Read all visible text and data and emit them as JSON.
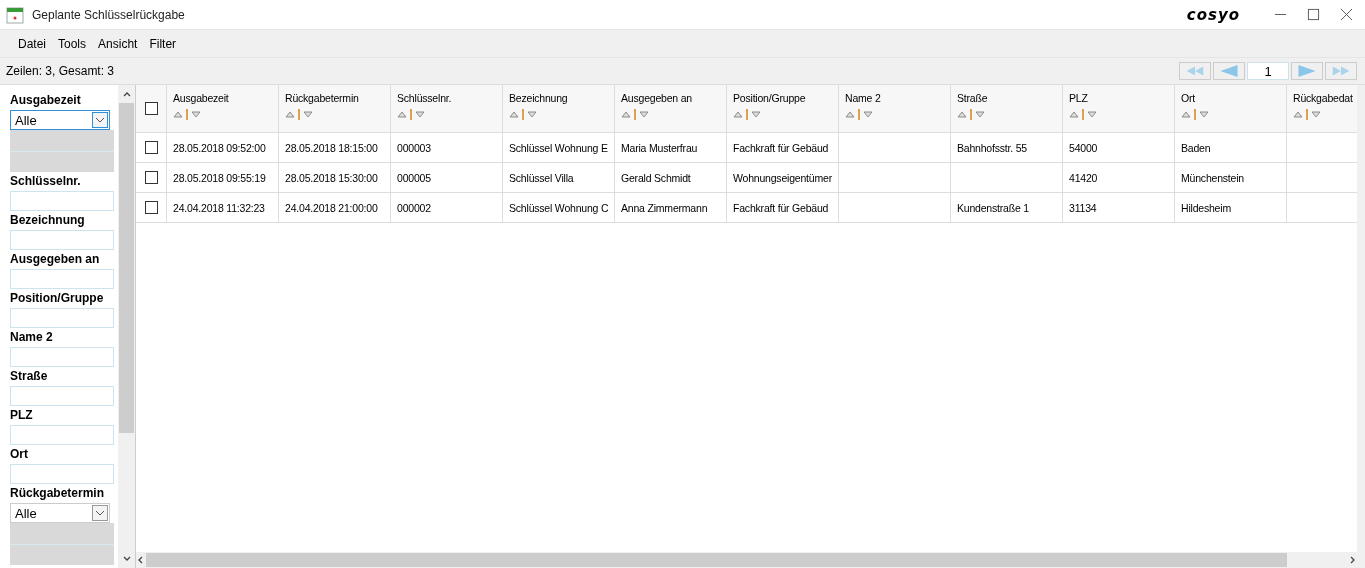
{
  "window": {
    "title": "Geplante Schlüsselrückgabe",
    "logo": "cosyo"
  },
  "menu": [
    "Datei",
    "Tools",
    "Ansicht",
    "Filter"
  ],
  "status": "Zeilen: 3, Gesamt: 3",
  "pager": {
    "page": "1"
  },
  "filters": [
    {
      "kind": "select",
      "label": "Ausgabezeit",
      "value": "Alle",
      "focused": true
    },
    {
      "kind": "text",
      "label": "Schlüsselnr."
    },
    {
      "kind": "text",
      "label": "Bezeichnung"
    },
    {
      "kind": "text",
      "label": "Ausgegeben an"
    },
    {
      "kind": "text",
      "label": "Position/Gruppe"
    },
    {
      "kind": "text",
      "label": "Name 2"
    },
    {
      "kind": "text",
      "label": "Straße"
    },
    {
      "kind": "text",
      "label": "PLZ"
    },
    {
      "kind": "text",
      "label": "Ort"
    },
    {
      "kind": "select",
      "label": "Rückgabetermin",
      "value": "Alle",
      "focused": false
    }
  ],
  "table": {
    "all_checked": false,
    "columns": [
      "Ausgabezeit",
      "Rückgabetermin",
      "Schlüsselnr.",
      "Bezeichnung",
      "Ausgegeben an",
      "Position/Gruppe",
      "Name 2",
      "Straße",
      "PLZ",
      "Ort",
      "Rückgabedat"
    ],
    "rows": [
      {
        "checked": false,
        "cells": [
          "28.05.2018 09:52:00",
          "28.05.2018 18:15:00",
          "000003",
          "Schlüssel Wohnung E",
          "Maria Musterfrau",
          "Fachkraft für Gebäud",
          "",
          "Bahnhofsstr. 55",
          "54000",
          "Baden",
          ""
        ]
      },
      {
        "checked": false,
        "cells": [
          "28.05.2018 09:55:19",
          "28.05.2018 15:30:00",
          "000005",
          "Schlüssel Villa",
          "Gerald Schmidt",
          "Wohnungseigentümer",
          "",
          "",
          "41420",
          "Münchenstein",
          ""
        ]
      },
      {
        "checked": false,
        "cells": [
          "24.04.2018 11:32:23",
          "24.04.2018 21:00:00",
          "000002",
          "Schlüssel Wohnung C",
          "Anna Zimmermann",
          "Fachkraft für Gebäud",
          "",
          "Kundenstraße 1",
          "31134",
          "Hildesheim",
          ""
        ]
      }
    ]
  }
}
